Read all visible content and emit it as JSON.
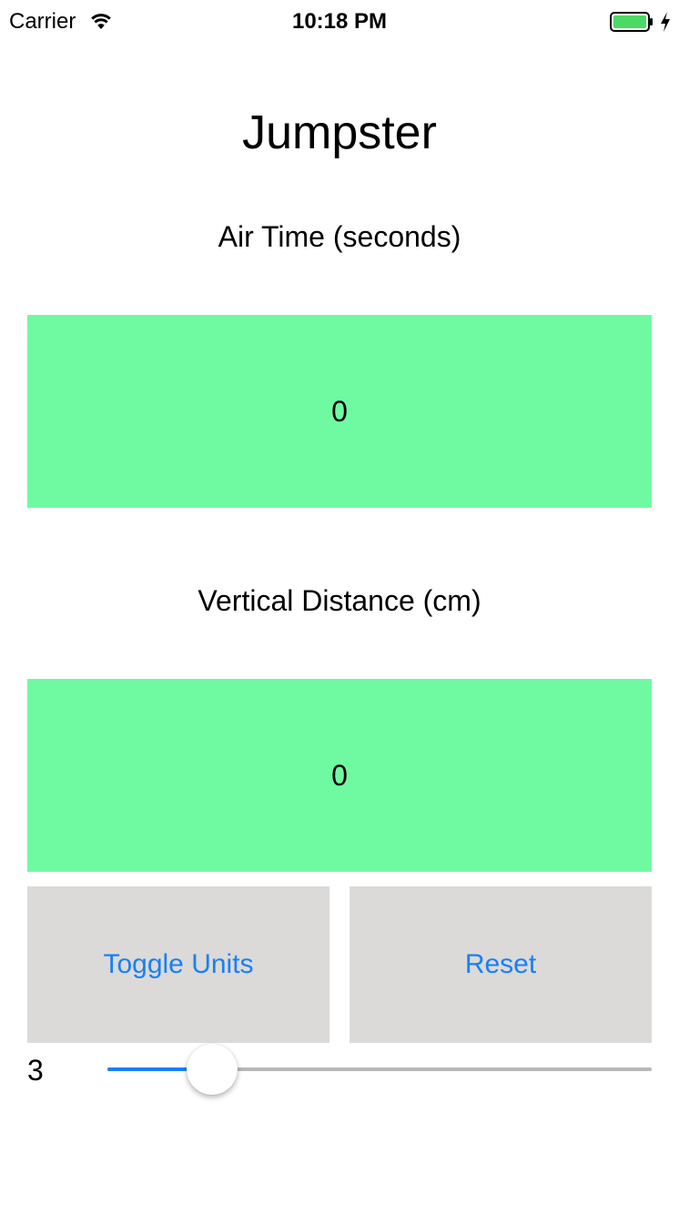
{
  "status_bar": {
    "carrier": "Carrier",
    "time": "10:18 PM"
  },
  "app": {
    "title": "Jumpster"
  },
  "air_time": {
    "label": "Air Time (seconds)",
    "value": "0"
  },
  "vertical_distance": {
    "label": "Vertical Distance (cm)",
    "value": "0"
  },
  "buttons": {
    "toggle_units": "Toggle Units",
    "reset": "Reset"
  },
  "slider": {
    "value_label": "3",
    "level": 0.193
  },
  "colors": {
    "value_box_bg": "#6ffaa2",
    "button_bg": "#dbdad8",
    "accent": "#1a7ff5",
    "battery": "#4cd964"
  },
  "icons": {
    "wifi": "wifi-icon",
    "battery": "battery-icon",
    "charging": "charging-bolt-icon"
  }
}
